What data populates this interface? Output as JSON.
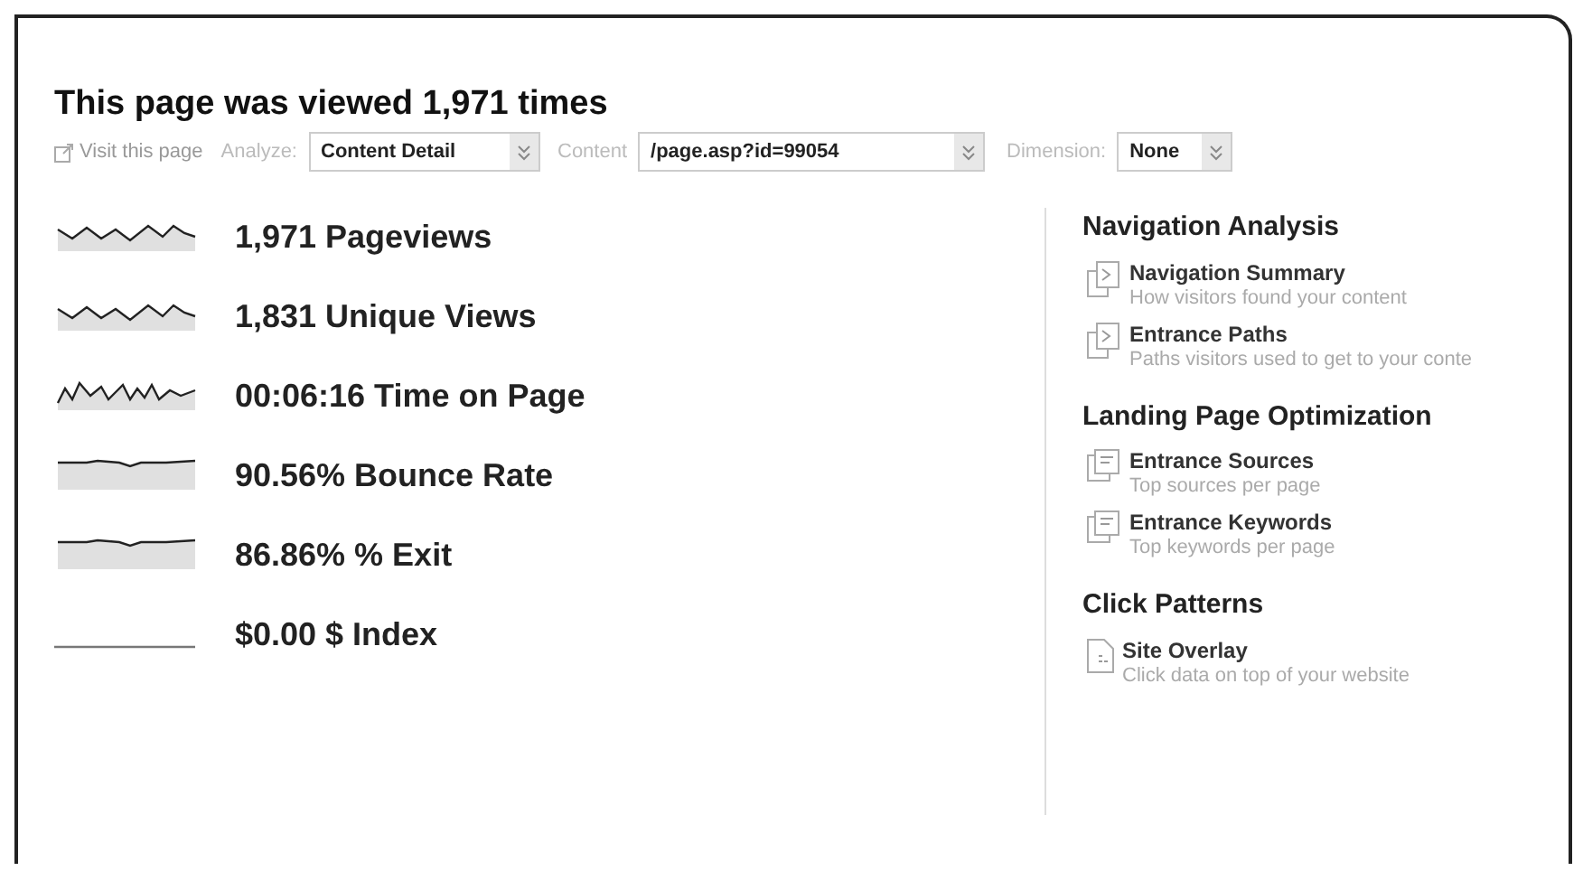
{
  "title": "This page was viewed 1,971 times",
  "toolbar": {
    "visit_link": "Visit this page",
    "analyze_label": "Analyze:",
    "analyze_value": "Content Detail",
    "content_label": "Content",
    "content_value": "/page.asp?id=99054",
    "dimension_label": "Dimension:",
    "dimension_value": "None"
  },
  "metrics": [
    {
      "kind": "wave",
      "text": "1,971 Pageviews"
    },
    {
      "kind": "wave",
      "text": "1,831 Unique Views"
    },
    {
      "kind": "spiky",
      "text": "00:06:16 Time on Page"
    },
    {
      "kind": "high",
      "text": "90.56% Bounce Rate"
    },
    {
      "kind": "high",
      "text": "86.86% % Exit"
    },
    {
      "kind": "zero",
      "text": "$0.00 $ Index"
    }
  ],
  "sections": [
    {
      "heading": "Navigation Analysis",
      "items": [
        {
          "kind": "navigation",
          "title": "Navigation Summary",
          "description": "How visitors found your content"
        },
        {
          "kind": "navigation",
          "title": "Entrance Paths",
          "description": "Paths visitors used to get to your conte"
        }
      ]
    },
    {
      "heading": "Landing Page Optimization",
      "items": [
        {
          "kind": "landing",
          "title": "Entrance Sources",
          "description": "Top sources per page"
        },
        {
          "kind": "landing",
          "title": "Entrance Keywords",
          "description": "Top keywords per page"
        }
      ]
    },
    {
      "heading": "Click Patterns",
      "items": [
        {
          "kind": "overlay",
          "title": "Site Overlay",
          "description": "Click data on top of your website"
        }
      ]
    }
  ]
}
